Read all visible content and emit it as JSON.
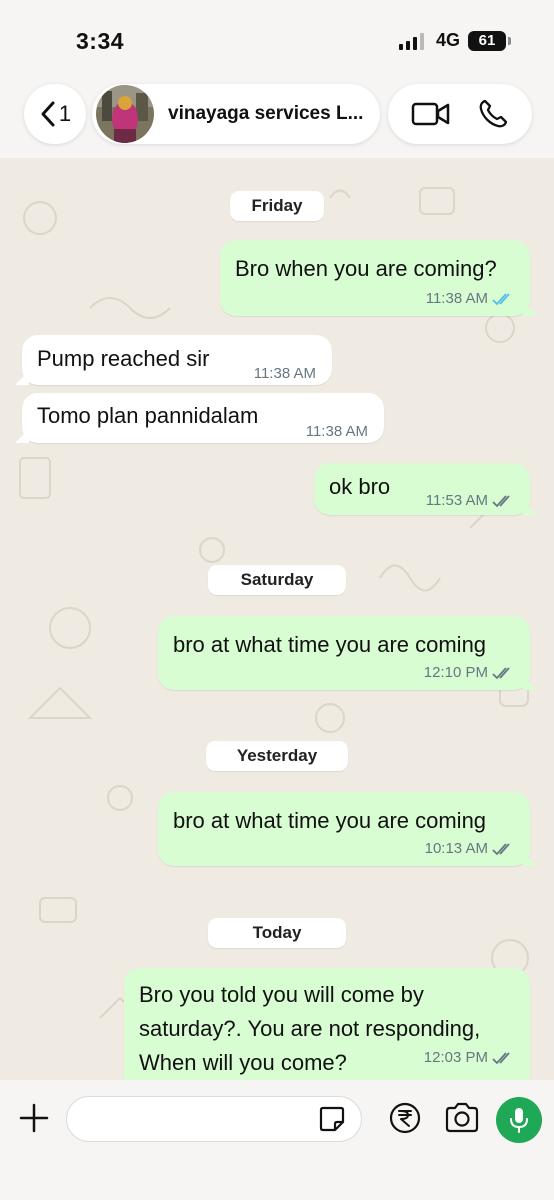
{
  "status_bar": {
    "time": "3:34",
    "network": "4G",
    "battery": "61"
  },
  "header": {
    "back_count": "1",
    "contact_name": "vinayaga services L..."
  },
  "composer": {
    "placeholder": ""
  },
  "colors": {
    "outgoing": "#d9fdd3",
    "incoming": "#ffffff",
    "mic": "#1fa855",
    "read_tick": "#53bdeb",
    "delivered_tick": "#667781"
  },
  "icons": [
    "back-chevron-icon",
    "video-call-icon",
    "voice-call-icon",
    "plus-icon",
    "sticker-icon",
    "rupee-icon",
    "camera-icon",
    "mic-icon"
  ],
  "chat": {
    "dates": [
      "Friday",
      "Saturday",
      "Yesterday",
      "Today"
    ],
    "messages": [
      {
        "dir": "out",
        "text": "Bro when you are coming?",
        "time": "11:38 AM",
        "status": "read"
      },
      {
        "dir": "in",
        "text": "Pump reached sir",
        "time": "11:38 AM"
      },
      {
        "dir": "in",
        "text": "Tomo plan pannidalam",
        "time": "11:38 AM"
      },
      {
        "dir": "out",
        "text": "ok bro",
        "time": "11:53 AM",
        "status": "delivered"
      },
      {
        "dir": "out",
        "text": "bro at what time you are coming",
        "time": "12:10 PM",
        "status": "delivered"
      },
      {
        "dir": "out",
        "text": "bro at what time you are coming",
        "time": "10:13 AM",
        "status": "delivered"
      },
      {
        "dir": "out",
        "lines": [
          "Bro you told you will come by",
          "saturday?. You are not responding,",
          "When will you come?"
        ],
        "time": "12:03 PM",
        "status": "delivered"
      }
    ]
  }
}
